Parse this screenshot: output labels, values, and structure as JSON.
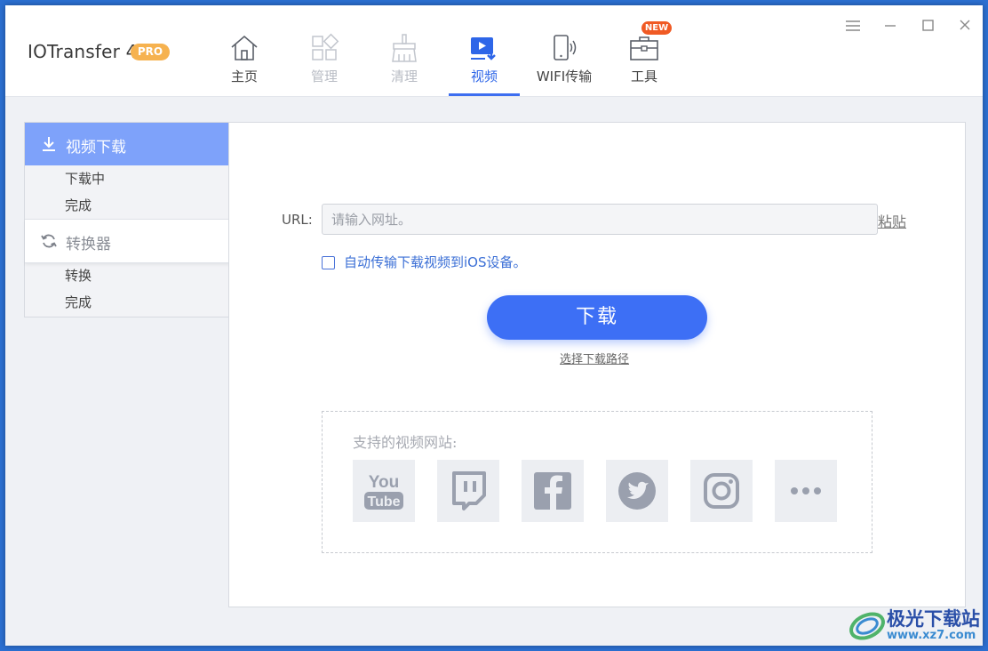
{
  "app": {
    "name": "IOTransfer 4",
    "badge": "PRO"
  },
  "nav": {
    "items": [
      {
        "label": "主页",
        "icon": "home-icon",
        "state": "normal"
      },
      {
        "label": "管理",
        "icon": "manage-icon",
        "state": "disabled"
      },
      {
        "label": "清理",
        "icon": "clean-icon",
        "state": "disabled"
      },
      {
        "label": "视频",
        "icon": "video-icon",
        "state": "active"
      },
      {
        "label": "WIFI传输",
        "icon": "wifi-transfer-icon",
        "state": "normal"
      },
      {
        "label": "工具",
        "icon": "toolbox-icon",
        "state": "normal"
      }
    ],
    "new_badge": "NEW"
  },
  "sidebar": {
    "download_header": "视频下载",
    "download_items": [
      "下载中",
      "完成"
    ],
    "converter_header": "转换器",
    "converter_items": [
      "转换",
      "完成"
    ]
  },
  "main": {
    "url_label": "URL:",
    "url_placeholder": "请输入网址。",
    "url_value": "",
    "paste_label": "粘贴",
    "auto_transfer_label": "自动传输下载视频到iOS设备。",
    "auto_transfer_checked": false,
    "download_button": "下载",
    "choose_path_label": "选择下载路径",
    "supported_sites_title": "支持的视频网站:",
    "sites": [
      "youtube-icon",
      "twitch-icon",
      "facebook-icon",
      "twitter-icon",
      "instagram-icon",
      "more-icon"
    ]
  },
  "watermark": {
    "title": "极光下载站",
    "url": "www.xz7.com"
  },
  "colors": {
    "accent": "#3d6ff5",
    "sidebar_active": "#7ea2fa",
    "new_badge": "#f05a24",
    "pro_badge": "#f6b24f"
  }
}
